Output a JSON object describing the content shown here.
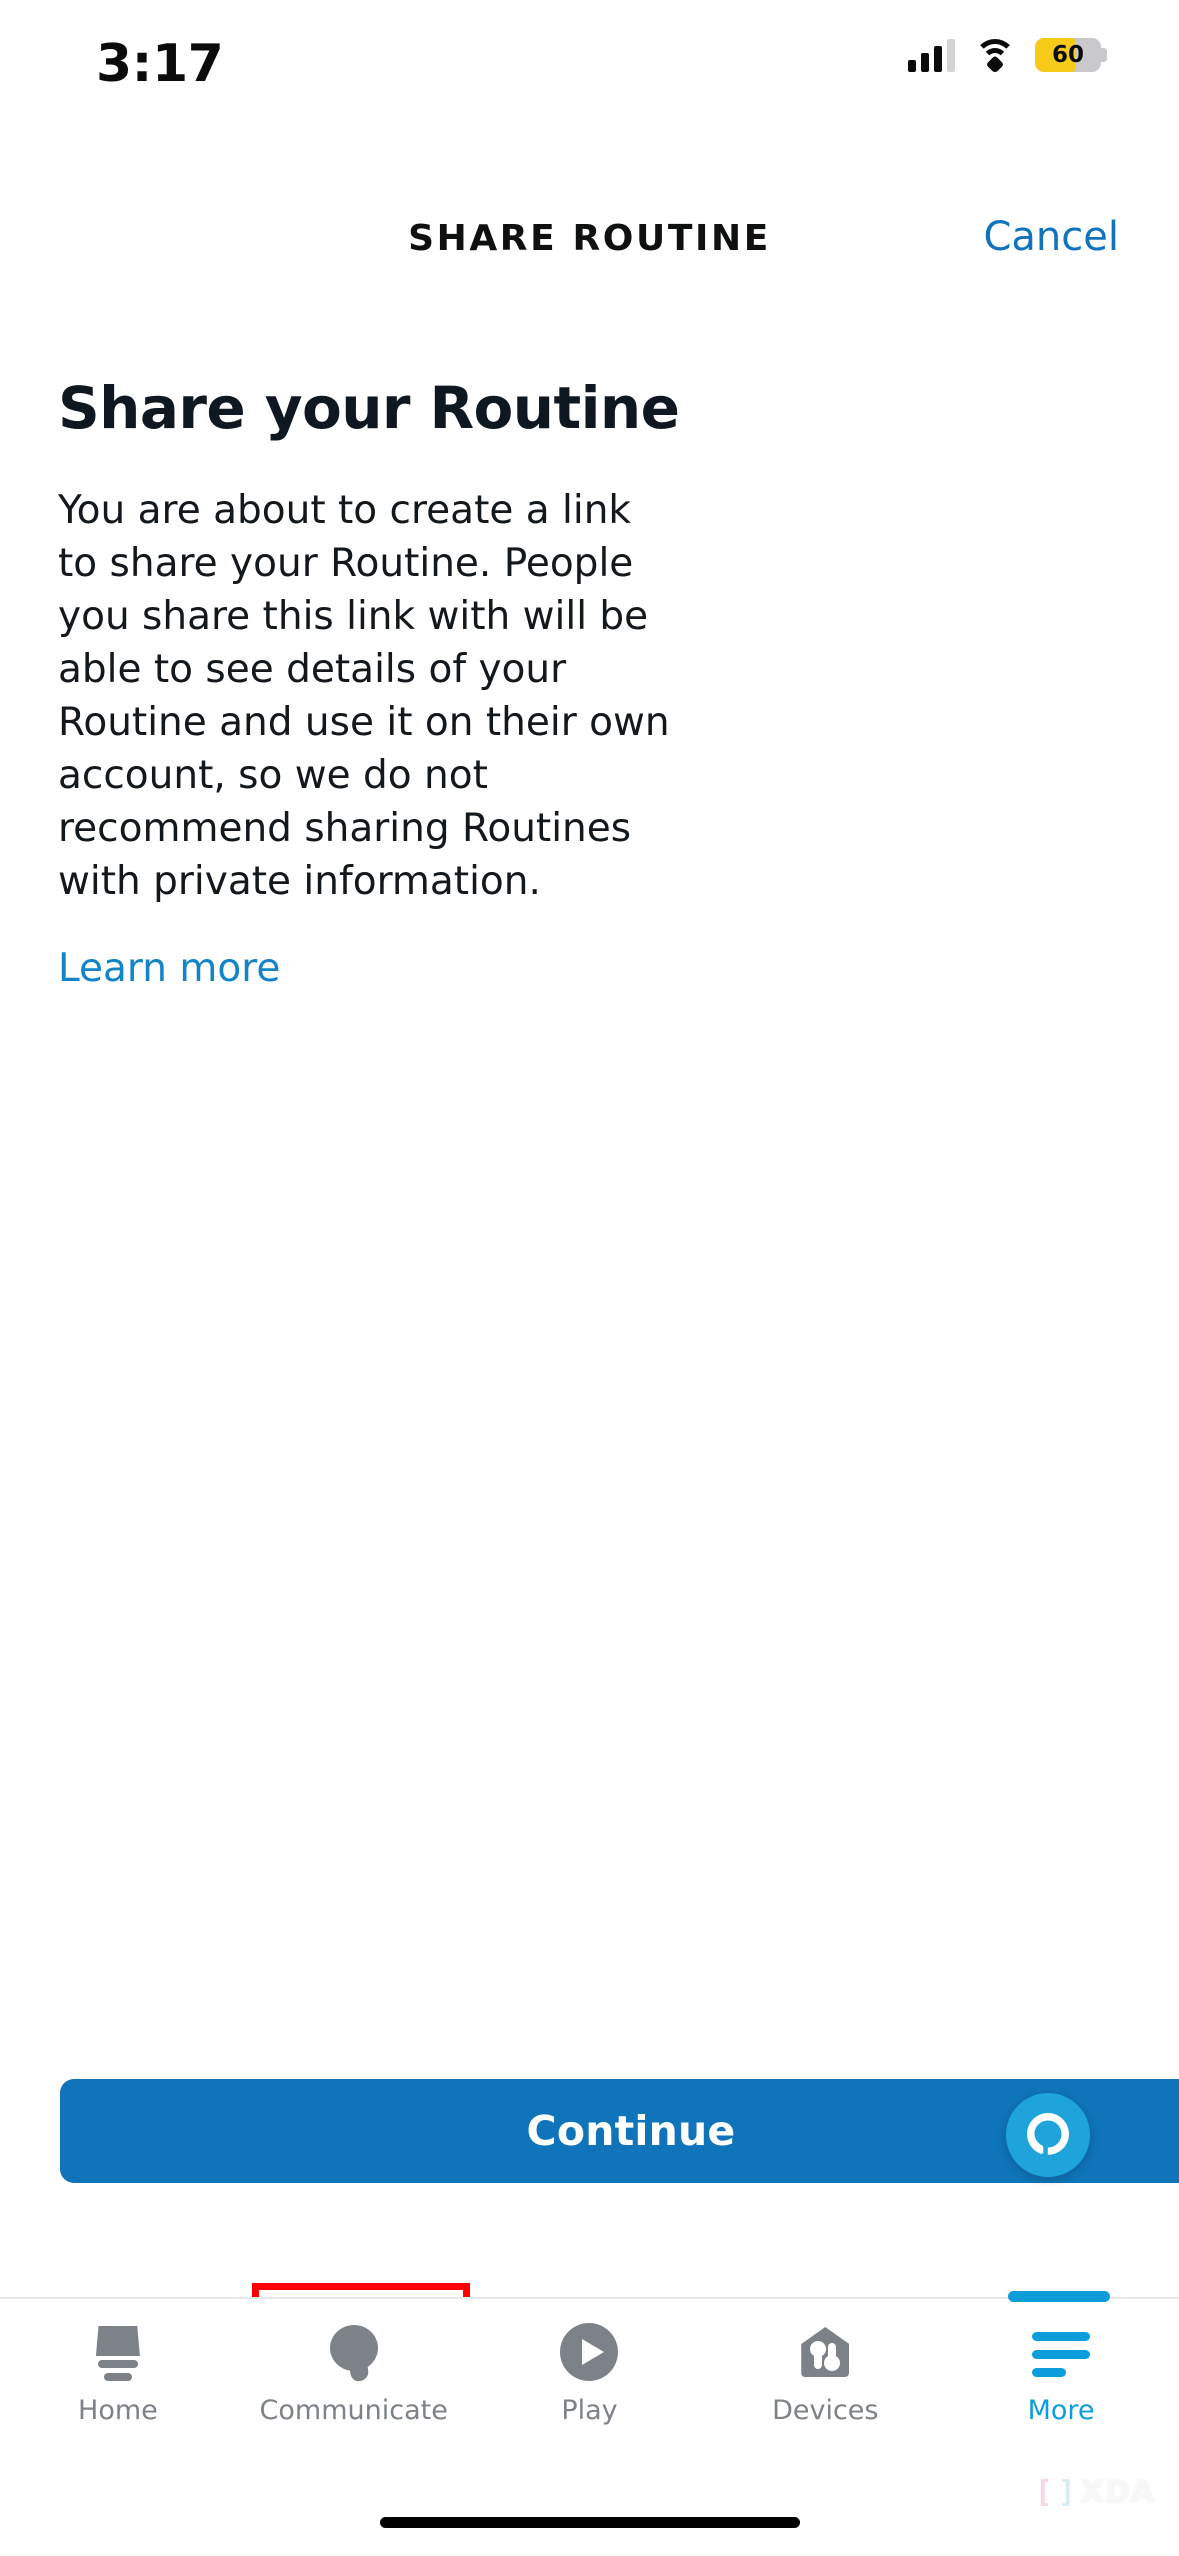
{
  "status_bar": {
    "time": "3:17",
    "cellular_icon": "cellular-signal-icon",
    "wifi_icon": "wifi-icon",
    "battery_icon": "battery-icon",
    "battery_level": "60",
    "battery_fill_color": "#f5cb18"
  },
  "nav": {
    "title": "SHARE ROUTINE",
    "cancel_label": "Cancel",
    "link_color": "#1073bb"
  },
  "main": {
    "heading": "Share your Routine",
    "body": "You are about to create a link to share your Routine. People you share this link with will be able to see details of your Routine and use it on their own account, so we do not recommend sharing Routines with private information.",
    "learn_more_label": "Learn more"
  },
  "footer": {
    "continue_label": "Continue",
    "continue_color": "#0f74b9",
    "annotation_color": "#ff0000",
    "alexa_fab_icon": "alexa-logo-icon",
    "alexa_fab_color": "#1ea4da"
  },
  "tab_bar": {
    "active_color": "#0d9ddb",
    "inactive_color": "#7c8287",
    "items": [
      {
        "label": "Home",
        "icon": "echo-speaker-icon",
        "active": false
      },
      {
        "label": "Communicate",
        "icon": "speech-bubble-icon",
        "active": false
      },
      {
        "label": "Play",
        "icon": "play-circle-icon",
        "active": false
      },
      {
        "label": "Devices",
        "icon": "home-devices-icon",
        "active": false
      },
      {
        "label": "More",
        "icon": "hamburger-menu-icon",
        "active": true
      }
    ]
  },
  "watermark": {
    "bracket_left": "[",
    "bracket_right": "]",
    "text": "XDA"
  }
}
